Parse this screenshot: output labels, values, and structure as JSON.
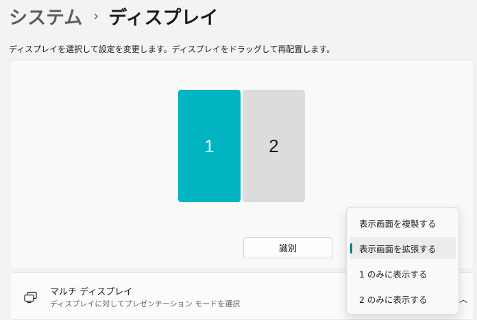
{
  "breadcrumb": {
    "parent": "システム",
    "separator": "›",
    "current": "ディスプレイ"
  },
  "description": "ディスプレイを選択して設定を変更します。ディスプレイをドラッグして再配置します。",
  "monitors": [
    {
      "label": "1",
      "selected": true,
      "color": "#00b4c1"
    },
    {
      "label": "2",
      "selected": false,
      "color": "#dcdcdc"
    }
  ],
  "identify_label": "識別",
  "multi_display": {
    "icon": "multi-monitor-icon",
    "title": "マルチ ディスプレイ",
    "subtitle": "ディスプレイに対してプレゼンテーション モードを選択"
  },
  "dropdown": {
    "options": [
      "表示画面を複製する",
      "表示画面を拡張する",
      "1 のみに表示する",
      "2 のみに表示する"
    ],
    "selected": "表示画面を拡張する",
    "accent": "#007f8a"
  }
}
